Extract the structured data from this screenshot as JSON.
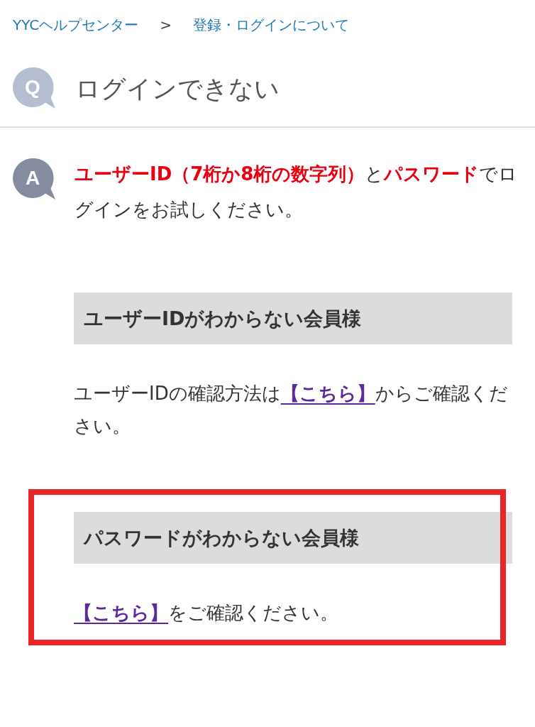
{
  "breadcrumb": [
    {
      "kind": "link",
      "text": "YYCヘルプセンター"
    },
    {
      "kind": "separator",
      "text": ">"
    },
    {
      "kind": "link",
      "text": "登録・ログインについて"
    }
  ],
  "question": {
    "badge": "Q",
    "title": "ログインできない"
  },
  "answer": {
    "badge": "A",
    "text": "**ユーザーID（7桁か8桁の数字列）**と**パスワード**でログインをお試しください。"
  },
  "sections": [
    {
      "heading": "ユーザーIDがわからない会員様",
      "highlighted": false,
      "body": [
        {
          "kind": "text",
          "text": "ユーザーIDの確認方法は"
        },
        {
          "kind": "link",
          "text": "【こちら】"
        },
        {
          "kind": "text",
          "text": "からご確認ください。"
        }
      ]
    },
    {
      "heading": "パスワードがわからない会員様",
      "highlighted": true,
      "body": [
        {
          "kind": "link",
          "text": "【こちら】"
        },
        {
          "kind": "text",
          "text": "をご確認ください。"
        }
      ]
    }
  ]
}
